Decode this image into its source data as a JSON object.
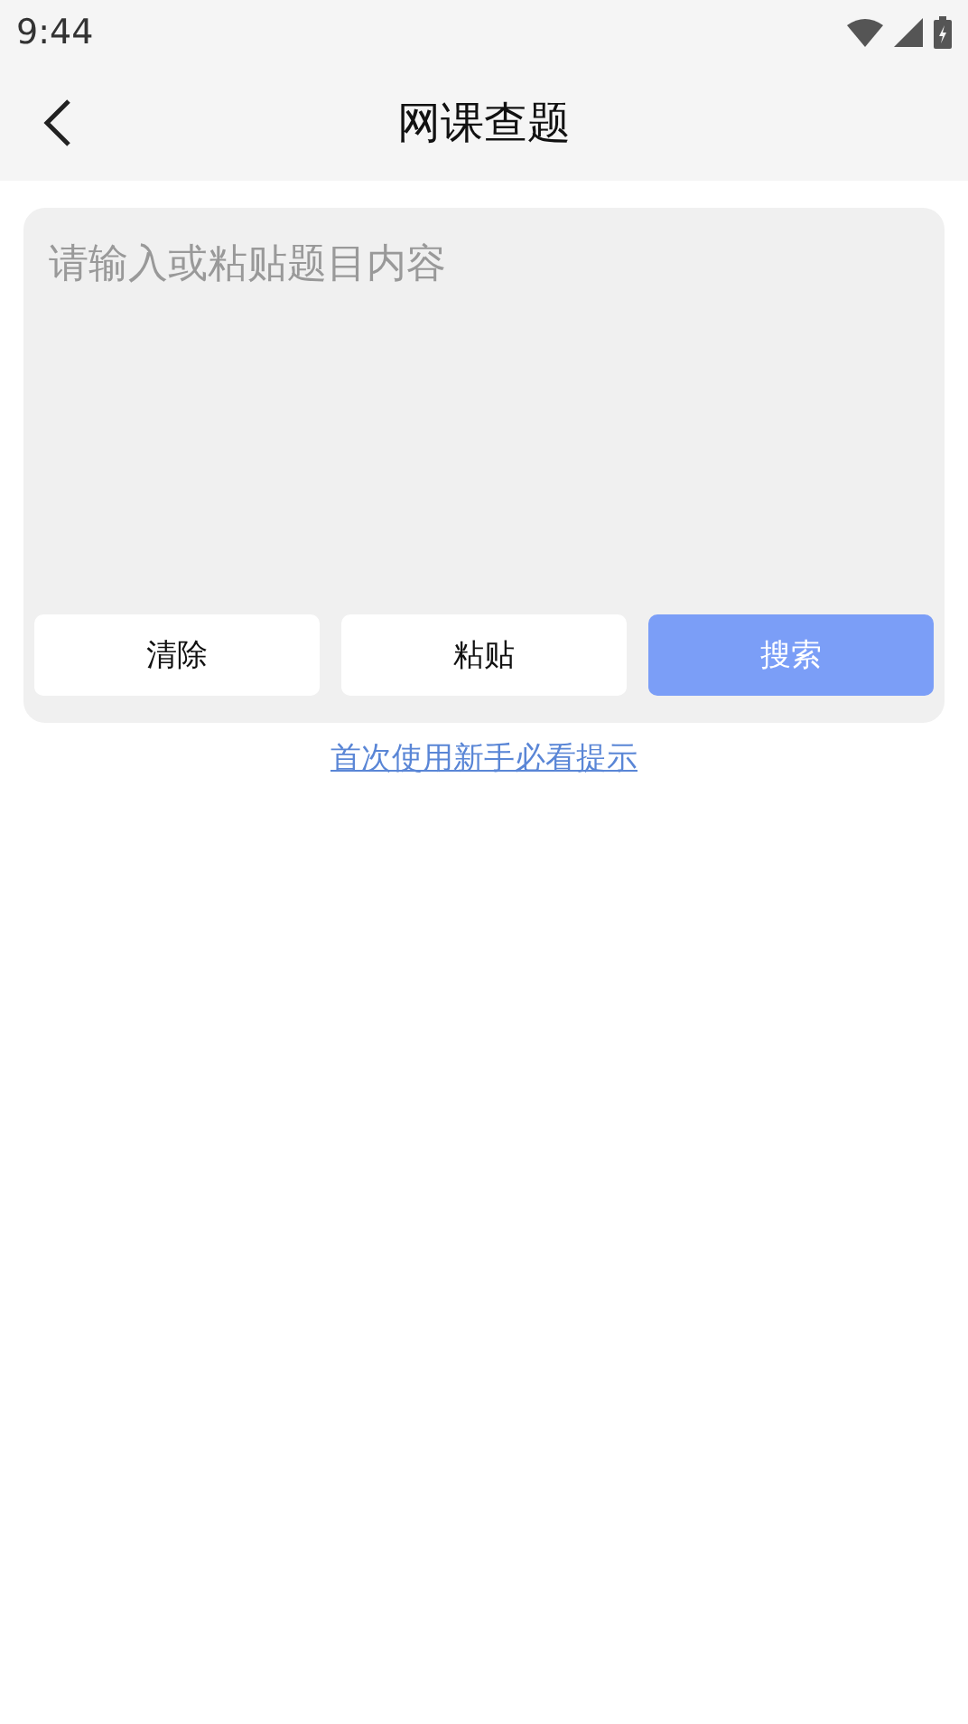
{
  "status_bar": {
    "time": "9:44"
  },
  "header": {
    "title": "网课查题"
  },
  "question_box": {
    "placeholder": "请输入或粘贴题目内容"
  },
  "buttons": [
    {
      "label": "清除",
      "kind": "plain"
    },
    {
      "label": "粘贴",
      "kind": "plain"
    },
    {
      "label": "搜索",
      "kind": "primary"
    }
  ],
  "help_link": "首次使用新手必看提示"
}
